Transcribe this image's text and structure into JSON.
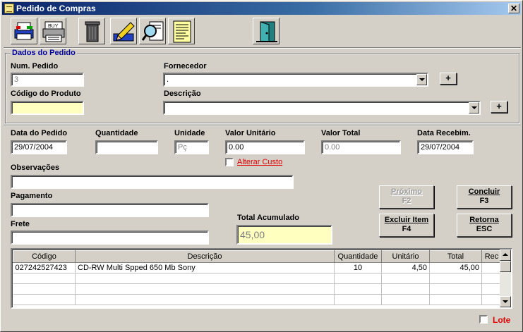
{
  "window": {
    "title": "Pedido de Compras",
    "close_glyph": "✕"
  },
  "toolbar": [
    {
      "icon": "printer-icon"
    },
    {
      "icon": "buy-printer-icon"
    },
    {
      "icon": "trash-icon"
    },
    {
      "icon": "edit-pencil-icon"
    },
    {
      "icon": "magnifier-search-icon"
    },
    {
      "icon": "notepad-icon"
    },
    {
      "icon": "exit-door-icon"
    }
  ],
  "dados_pedido": {
    "title": "Dados do  Pedido",
    "num_pedido_label": "Num. Pedido",
    "num_pedido_value": "3",
    "fornecedor_label": "Fornecedor",
    "fornecedor_value": ".",
    "codigo_produto_label": "Código do Produto",
    "codigo_produto_value": "",
    "descricao_label": "Descrição",
    "descricao_value": "",
    "plus_label": "+"
  },
  "details": {
    "data_pedido_label": "Data do Pedido",
    "data_pedido_value": "29/07/2004",
    "quantidade_label": "Quantidade",
    "quantidade_value": "",
    "unidade_label": "Unidade",
    "unidade_value": "Pç",
    "valor_unitario_label": "Valor Unitário",
    "valor_unitario_value": "0.00",
    "valor_total_label": "Valor Total",
    "valor_total_value": "0.00",
    "data_recebim_label": "Data Recebim.",
    "data_recebim_value": "29/07/2004",
    "alterar_custo_label": "Alterar Custo",
    "observacoes_label": "Observações",
    "observacoes_value": "",
    "pagamento_label": "Pagamento",
    "pagamento_value": "",
    "frete_label": "Frete",
    "frete_value": "",
    "total_acumulado_label": "Total Acumulado",
    "total_acumulado_value": "45,00"
  },
  "buttons": {
    "proximo": {
      "line1": "Próximo",
      "line2": "F2"
    },
    "concluir": {
      "line1": "Concluir",
      "line2": "F3"
    },
    "excluir": {
      "line1": "Excluir Item",
      "line2": "F4"
    },
    "retorna": {
      "line1": "Retorna",
      "line2": "ESC"
    }
  },
  "grid": {
    "columns": [
      "Código",
      "Descrição",
      "Quantidade",
      "Unitário",
      "Total",
      "Rec"
    ],
    "rows": [
      {
        "codigo": "027242527423",
        "descricao": "CD-RW Multi Spped 650 Mb Sony",
        "quantidade": "10",
        "unitario": "4,50",
        "total": "45,00",
        "rec": ""
      }
    ]
  },
  "lote_label": "Lote"
}
